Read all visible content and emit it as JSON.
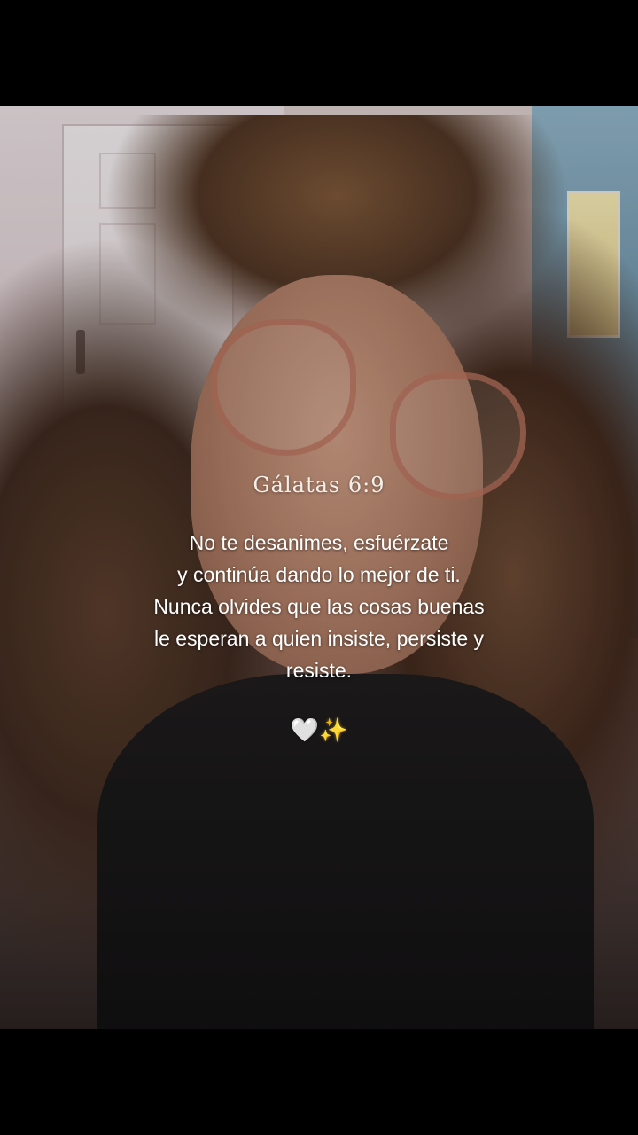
{
  "caption": {
    "reference": "Gálatas 6:9",
    "lines": [
      "No te desanimes,  esfuérzate",
      "y continúa dando lo mejor de ti.",
      "Nunca olvides que las cosas buenas",
      "le esperan a quien insiste, persiste y",
      "resiste."
    ],
    "emoji": {
      "heart": "🤍",
      "sparkles": "✨"
    }
  },
  "colors": {
    "background": "#000000",
    "text": "#ffffff"
  }
}
